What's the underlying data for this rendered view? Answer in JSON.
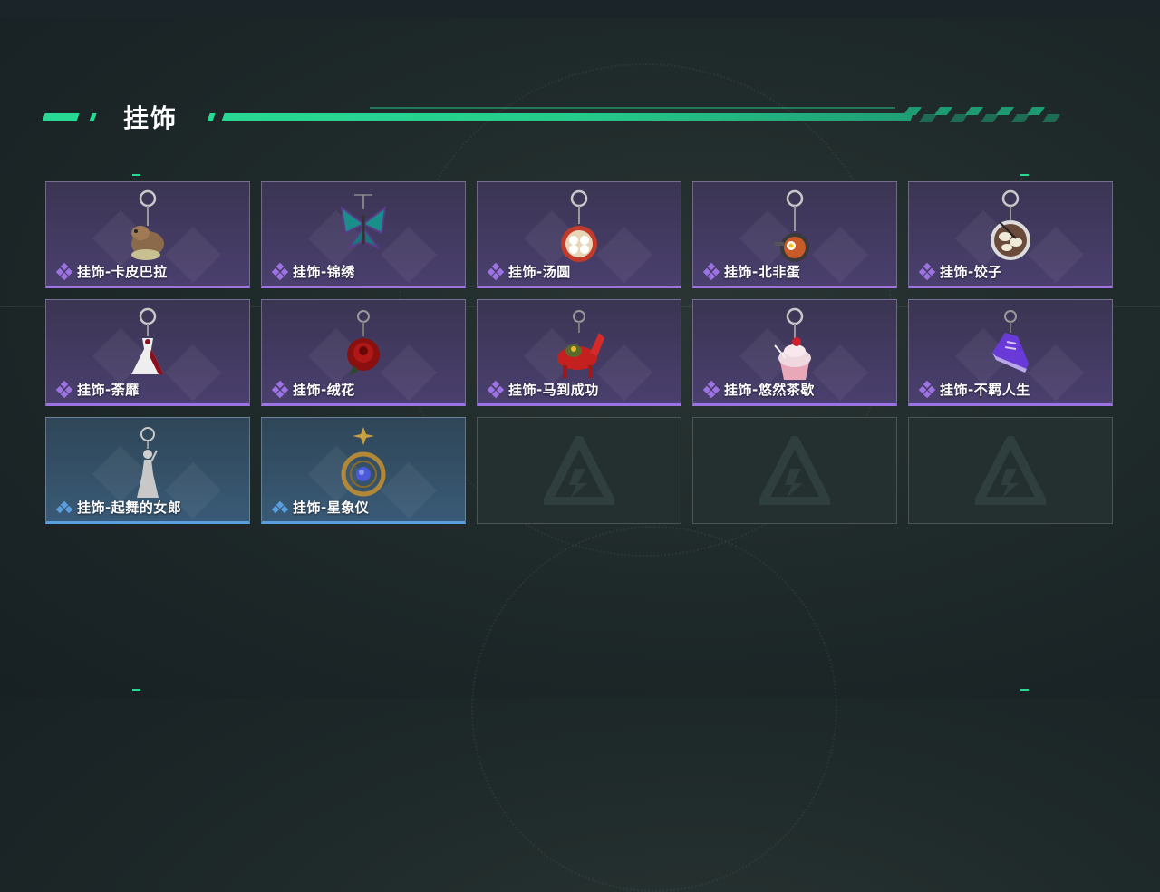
{
  "section": {
    "title": "挂饰"
  },
  "colors": {
    "accent": "#28d895",
    "purple_rarity": "#9d72e3",
    "blue_rarity": "#5b9ee0"
  },
  "items": [
    {
      "name": "挂饰-卡皮巴拉",
      "rarity": "purple",
      "icon": "capybara-charm-icon"
    },
    {
      "name": "挂饰-锦绣",
      "rarity": "purple",
      "icon": "butterfly-charm-icon"
    },
    {
      "name": "挂饰-汤圆",
      "rarity": "purple",
      "icon": "tangyuan-charm-icon"
    },
    {
      "name": "挂饰-北非蛋",
      "rarity": "purple",
      "icon": "shakshuka-charm-icon"
    },
    {
      "name": "挂饰-饺子",
      "rarity": "purple",
      "icon": "dumpling-charm-icon"
    },
    {
      "name": "挂饰-荼靡",
      "rarity": "purple",
      "icon": "dress-charm-icon"
    },
    {
      "name": "挂饰-绒花",
      "rarity": "purple",
      "icon": "rose-charm-icon"
    },
    {
      "name": "挂饰-马到成功",
      "rarity": "purple",
      "icon": "horse-charm-icon"
    },
    {
      "name": "挂饰-悠然茶歇",
      "rarity": "purple",
      "icon": "cupcake-charm-icon"
    },
    {
      "name": "挂饰-不羁人生",
      "rarity": "purple",
      "icon": "sneaker-charm-icon"
    },
    {
      "name": "挂饰-起舞的女郎",
      "rarity": "blue",
      "icon": "dancer-charm-icon"
    },
    {
      "name": "挂饰-星象仪",
      "rarity": "blue",
      "icon": "astrolabe-charm-icon"
    }
  ],
  "empty_slots": 3
}
